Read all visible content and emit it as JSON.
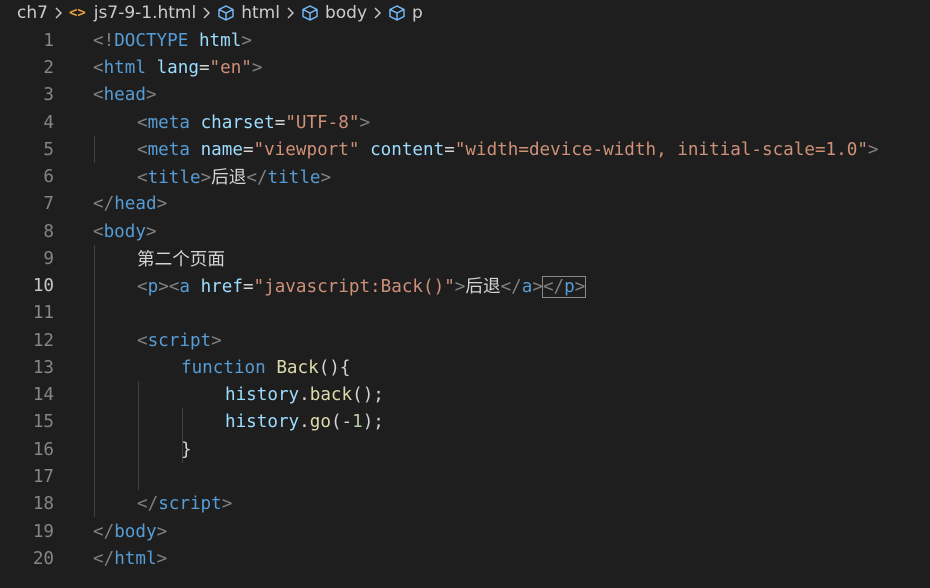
{
  "breadcrumb": {
    "folder": "ch7",
    "file": "js7-9-1.html",
    "file_icon": "<>",
    "symbols": [
      "html",
      "body",
      "p"
    ]
  },
  "editor": {
    "line_numbers": [
      "1",
      "2",
      "3",
      "4",
      "5",
      "6",
      "7",
      "8",
      "9",
      "10",
      "11",
      "12",
      "13",
      "14",
      "15",
      "16",
      "17",
      "18",
      "19",
      "20"
    ],
    "l1": {
      "open": "<!",
      "doctype": "DOCTYPE",
      "sp": " ",
      "name": "html",
      "close": ">"
    },
    "l2": {
      "open": "<",
      "tag": "html",
      "sp": " ",
      "attr": "lang",
      "eq": "=",
      "val": "\"en\"",
      "close": ">"
    },
    "l3": {
      "open": "<",
      "tag": "head",
      "close": ">"
    },
    "l4": {
      "open": "<",
      "tag": "meta",
      "sp": " ",
      "attr": "charset",
      "eq": "=",
      "val": "\"UTF-8\"",
      "close": ">"
    },
    "l5": {
      "open": "<",
      "tag": "meta",
      "sp": " ",
      "attr1": "name",
      "eq1": "=",
      "val1": "\"viewport\"",
      "sp2": " ",
      "attr2": "content",
      "eq2": "=",
      "val2": "\"width=device-width, initial-scale=1.0\"",
      "close": ">"
    },
    "l6": {
      "open": "<",
      "tag": "title",
      "close": ">",
      "text": "后退",
      "open2": "</",
      "tag2": "title",
      "close2": ">"
    },
    "l7": {
      "open": "</",
      "tag": "head",
      "close": ">"
    },
    "l8": {
      "open": "<",
      "tag": "body",
      "close": ">"
    },
    "l9": {
      "text": "第二个页面"
    },
    "l10": {
      "open": "<",
      "tag": "p",
      "close": ">",
      "open_a": "<",
      "tag_a": "a",
      "sp": " ",
      "attr": "href",
      "eq": "=",
      "val": "\"javascript:Back()\"",
      "close_a": ">",
      "text": "后退",
      "open_ea": "</",
      "tag_ea": "a",
      "close_ea": ">",
      "open_ep": "</",
      "tag_ep": "p",
      "close_ep": ">"
    },
    "l12": {
      "open": "<",
      "tag": "script",
      "close": ">"
    },
    "l13": {
      "kw": "function",
      "sp": " ",
      "fn": "Back",
      "punc": "(){"
    },
    "l14": {
      "obj": "history",
      "dot": ".",
      "fn": "back",
      "punc": "();"
    },
    "l15": {
      "obj": "history",
      "dot": ".",
      "fn": "go",
      "p1": "(-",
      "num": "1",
      "p2": ");"
    },
    "l16": {
      "punc": "}"
    },
    "l18": {
      "open": "</",
      "tag": "script",
      "close": ">"
    },
    "l19": {
      "open": "</",
      "tag": "body",
      "close": ">"
    },
    "l20": {
      "open": "</",
      "tag": "html",
      "close": ">"
    }
  },
  "colors": {
    "background": "#1e1e1e",
    "tag": "#569cd6",
    "attribute": "#9cdcfe",
    "string": "#ce9178",
    "function": "#dcdcaa",
    "number": "#b5cea8",
    "line_number": "#858585"
  }
}
